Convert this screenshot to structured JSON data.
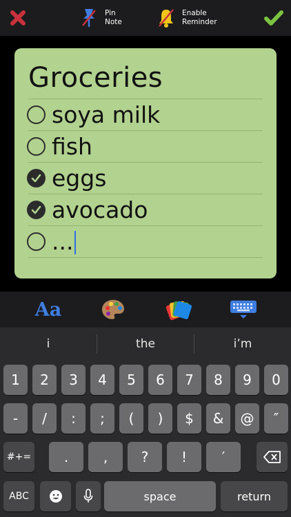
{
  "toolbar": {
    "pin_label": "Pin\nNote",
    "reminder_label": "Enable\nReminder"
  },
  "note": {
    "title": "Groceries",
    "background": "#b2d28f",
    "items": [
      {
        "text": "soya milk",
        "checked": false
      },
      {
        "text": "fish",
        "checked": false
      },
      {
        "text": "eggs",
        "checked": true
      },
      {
        "text": "avocado",
        "checked": true
      },
      {
        "text": "...",
        "checked": false
      }
    ]
  },
  "format_bar": {
    "font_label": "Aa"
  },
  "keyboard": {
    "suggestions": [
      "i",
      "the",
      "i’m"
    ],
    "row1": [
      "1",
      "2",
      "3",
      "4",
      "5",
      "6",
      "7",
      "8",
      "9",
      "0"
    ],
    "row2": [
      "-",
      "/",
      ":",
      ";",
      "(",
      ")",
      "$",
      "&",
      "@",
      "″"
    ],
    "row3": [
      ".",
      ",",
      "?",
      "!",
      "′"
    ],
    "symbols_key": "#+=",
    "abc_key": "ABC",
    "space_key": "space",
    "return_key": "return"
  },
  "colors": {
    "close": "#c8323c",
    "done": "#7cc242",
    "pin": "#3f7de0",
    "reminder": "#f0c419"
  }
}
